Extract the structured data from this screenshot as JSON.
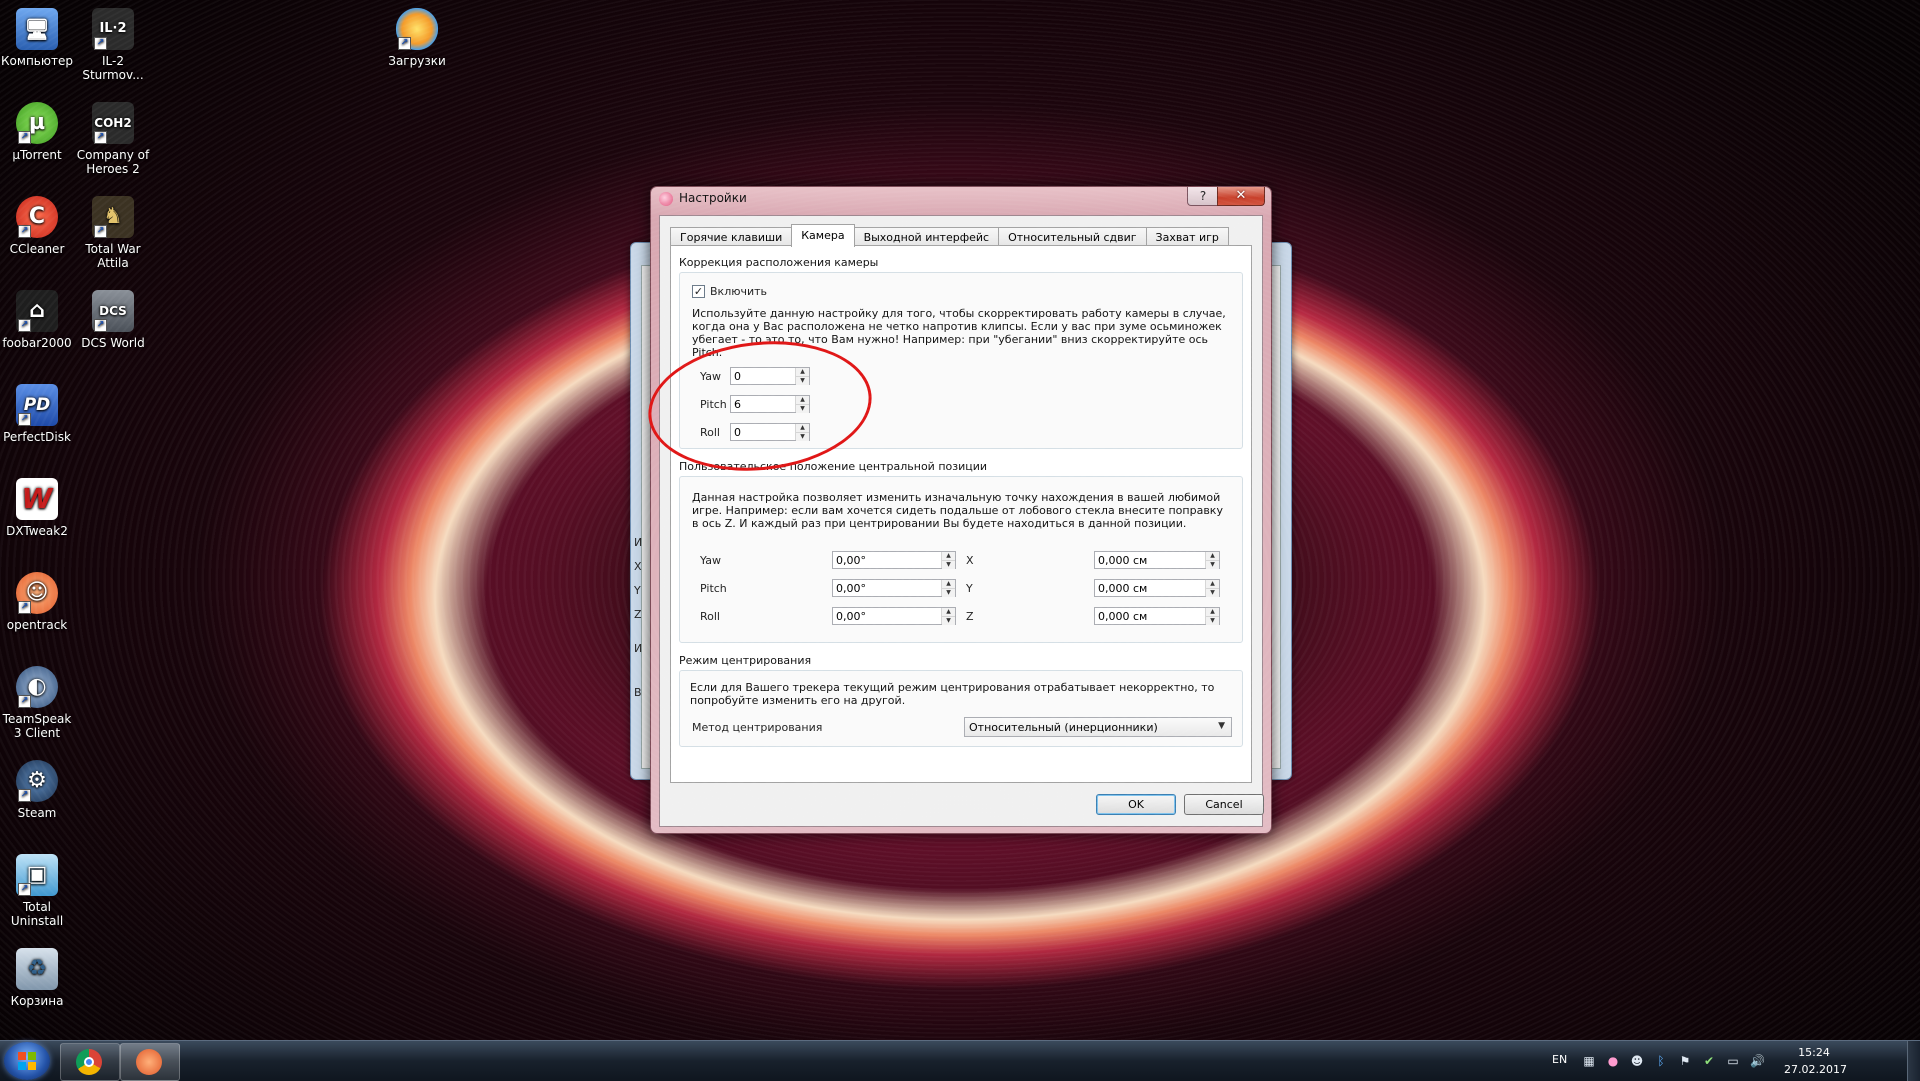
{
  "desktop_icons": [
    {
      "label": "Компьютер",
      "icon": "computer-icon",
      "color": "#3a7bd5"
    },
    {
      "label": "IL-2 Sturmov...",
      "icon": "il2-game-icon",
      "color": "#2b2b2b",
      "glyph": "IL·2"
    },
    {
      "label": "Загрузки",
      "icon": "downloads-butterfly-icon",
      "color": "#5fa8e8"
    },
    {
      "label": "µTorrent",
      "icon": "utorrent-icon",
      "color": "#5bbf3a",
      "glyph": "µ"
    },
    {
      "label": "Company of Heroes 2",
      "icon": "company-of-heroes-icon",
      "color": "#2a2a2a",
      "glyph": "COH2"
    },
    {
      "label": "CCleaner",
      "icon": "ccleaner-icon",
      "color": "#d83b2b",
      "glyph": "C"
    },
    {
      "label": "Total War Attila",
      "icon": "total-war-attila-icon",
      "color": "#3b3222",
      "glyph": "♞"
    },
    {
      "label": "foobar2000",
      "icon": "foobar2000-icon",
      "color": "#222222",
      "glyph": "⌂"
    },
    {
      "label": "DCS World",
      "icon": "dcs-world-icon",
      "color": "#555b63",
      "glyph": "DCS"
    },
    {
      "label": "PerfectDisk",
      "icon": "perfectdisk-icon",
      "color": "#2c5fb8",
      "glyph": "PD"
    },
    {
      "label": "DXTweak2",
      "icon": "dxtweak2-icon",
      "color": "#c41a1a",
      "glyph": "W"
    },
    {
      "label": "opentrack",
      "icon": "opentrack-icon",
      "color": "#e8743a",
      "glyph": "☺"
    },
    {
      "label": "TeamSpeak 3 Client",
      "icon": "teamspeak-icon",
      "color": "#3c5e8a",
      "glyph": "◐"
    },
    {
      "label": "Steam",
      "icon": "steam-icon",
      "color": "#2a4b75",
      "glyph": "⚙"
    },
    {
      "label": "Total Uninstall",
      "icon": "total-uninstall-icon",
      "color": "#4fa7d8",
      "glyph": "▣"
    },
    {
      "label": "Корзина",
      "icon": "recycle-bin-icon",
      "color": "#8fa3b5",
      "glyph": "♻"
    }
  ],
  "dialog": {
    "title": "Настройки",
    "help_label": "?",
    "close_label": "✕",
    "tabs": [
      {
        "label": "Горячие клавиши",
        "active": false
      },
      {
        "label": "Камера",
        "active": true
      },
      {
        "label": "Выходной интерфейс",
        "active": false
      },
      {
        "label": "Относительный сдвиг",
        "active": false
      },
      {
        "label": "Захват игр",
        "active": false
      }
    ],
    "camera_correction": {
      "title": "Коррекция расположения камеры",
      "enable_label": "Включить",
      "enabled_mark": "✓",
      "description": "Используйте данную настройку для того, чтобы скорректировать работу камеры в случае, когда она у Вас расположена не четко напротив клипсы. Если у вас при зуме осьминожек убегает - то это то, что Вам нужно! Например: при \"убегании\" вниз скорректируйте ось Pitch.",
      "fields": [
        {
          "label": "Yaw",
          "value": "0"
        },
        {
          "label": "Pitch",
          "value": "6"
        },
        {
          "label": "Roll",
          "value": "0"
        }
      ]
    },
    "center_position": {
      "title": "Пользовательское положение центральной позиции",
      "description": "Данная настройка позволяет изменить изначальную точку нахождения в вашей любимой игре. Например: если вам хочется сидеть подальше от лобового стекла внесите поправку в ось Z. И каждый раз при центрировании Вы будете находиться в данной позиции.",
      "rows": [
        {
          "label": "Yaw",
          "angle": "0,00°",
          "axis": "X",
          "offset": "0,000 см"
        },
        {
          "label": "Pitch",
          "angle": "0,00°",
          "axis": "Y",
          "offset": "0,000 см"
        },
        {
          "label": "Roll",
          "angle": "0,00°",
          "axis": "Z",
          "offset": "0,000 см"
        }
      ]
    },
    "centering_mode": {
      "title": "Режим центрирования",
      "description": "Если для Вашего трекера текущий режим центрирования отрабатывает некорректно, то попробуйте изменить его на другой.",
      "method_label": "Метод центрирования",
      "method_value": "Относительный (инерционники)"
    },
    "ok_label": "OK",
    "cancel_label": "Cancel"
  },
  "background_window": {
    "letters": [
      "И",
      "X",
      "Y",
      "Z",
      "И",
      "В"
    ]
  },
  "taskbar": {
    "items": [
      {
        "icon": "chrome-icon",
        "color": "#e0a020"
      },
      {
        "icon": "opentrack-taskbar-icon",
        "color": "#e8743a"
      }
    ],
    "tray": {
      "language": "EN",
      "time": "15:24",
      "date": "27.02.2017",
      "icons": [
        "network-monitor-icon",
        "opentrack-tray-icon",
        "alien-icon",
        "bluetooth-icon",
        "flag-icon",
        "security-icon",
        "network-icon",
        "volume-icon"
      ]
    }
  },
  "colors": {
    "annotation_circle": "#e01515",
    "dialog_frame": "#d9a8b2"
  }
}
